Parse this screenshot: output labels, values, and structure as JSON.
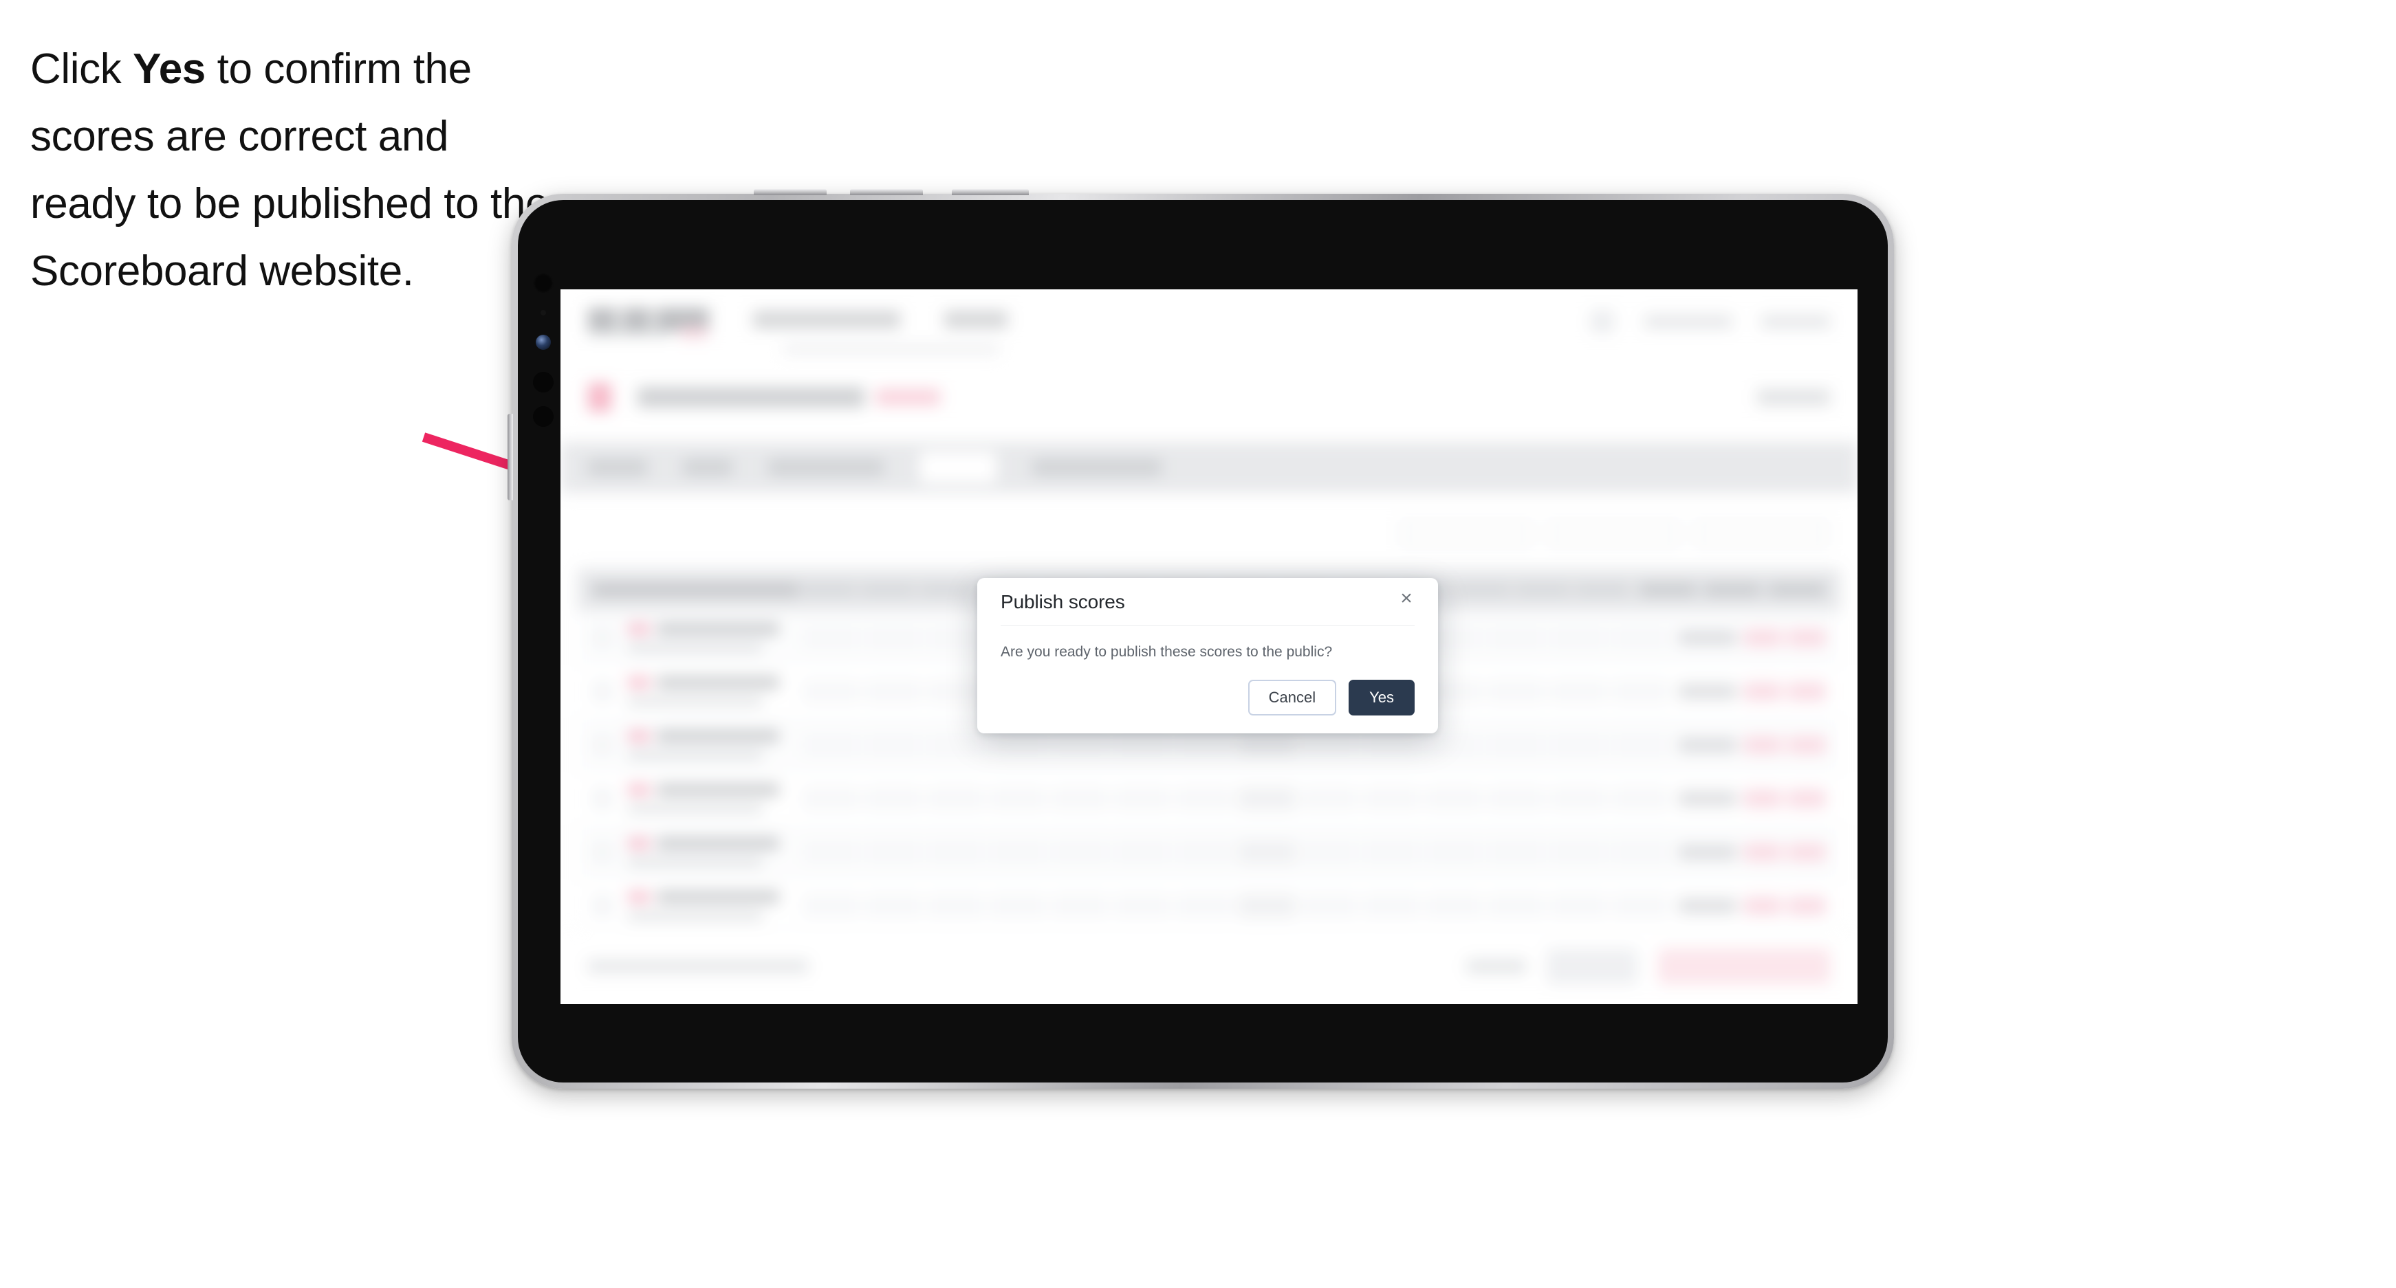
{
  "instruction": {
    "part1": "Click ",
    "emphasis": "Yes",
    "part2": " to confirm the scores are correct and ready to be published to the Scoreboard website."
  },
  "annotation": {
    "arrow_color": "#ED2560",
    "arrow_name": "pointer-arrow-to-yes-button"
  },
  "device": {
    "type": "tablet",
    "orientation": "landscape",
    "frame_color": "#c2c2c5",
    "body_color": "#0d0d0d"
  },
  "modal": {
    "title": "Publish scores",
    "body": "Are you ready to publish these scores to the public?",
    "close_label": "×",
    "cancel_label": "Cancel",
    "confirm_label": "Yes",
    "confirm_color": "#2B3A4F",
    "cancel_border_color": "#C8D2E4"
  },
  "background_app": {
    "blurred": true,
    "note": "Background application is blurred and its text is not legible in the screenshot.",
    "regions": [
      "top-navigation-bar",
      "competition-title-row",
      "tab-strip",
      "filter-toolbar",
      "scores-table",
      "bottom-action-bar"
    ]
  }
}
